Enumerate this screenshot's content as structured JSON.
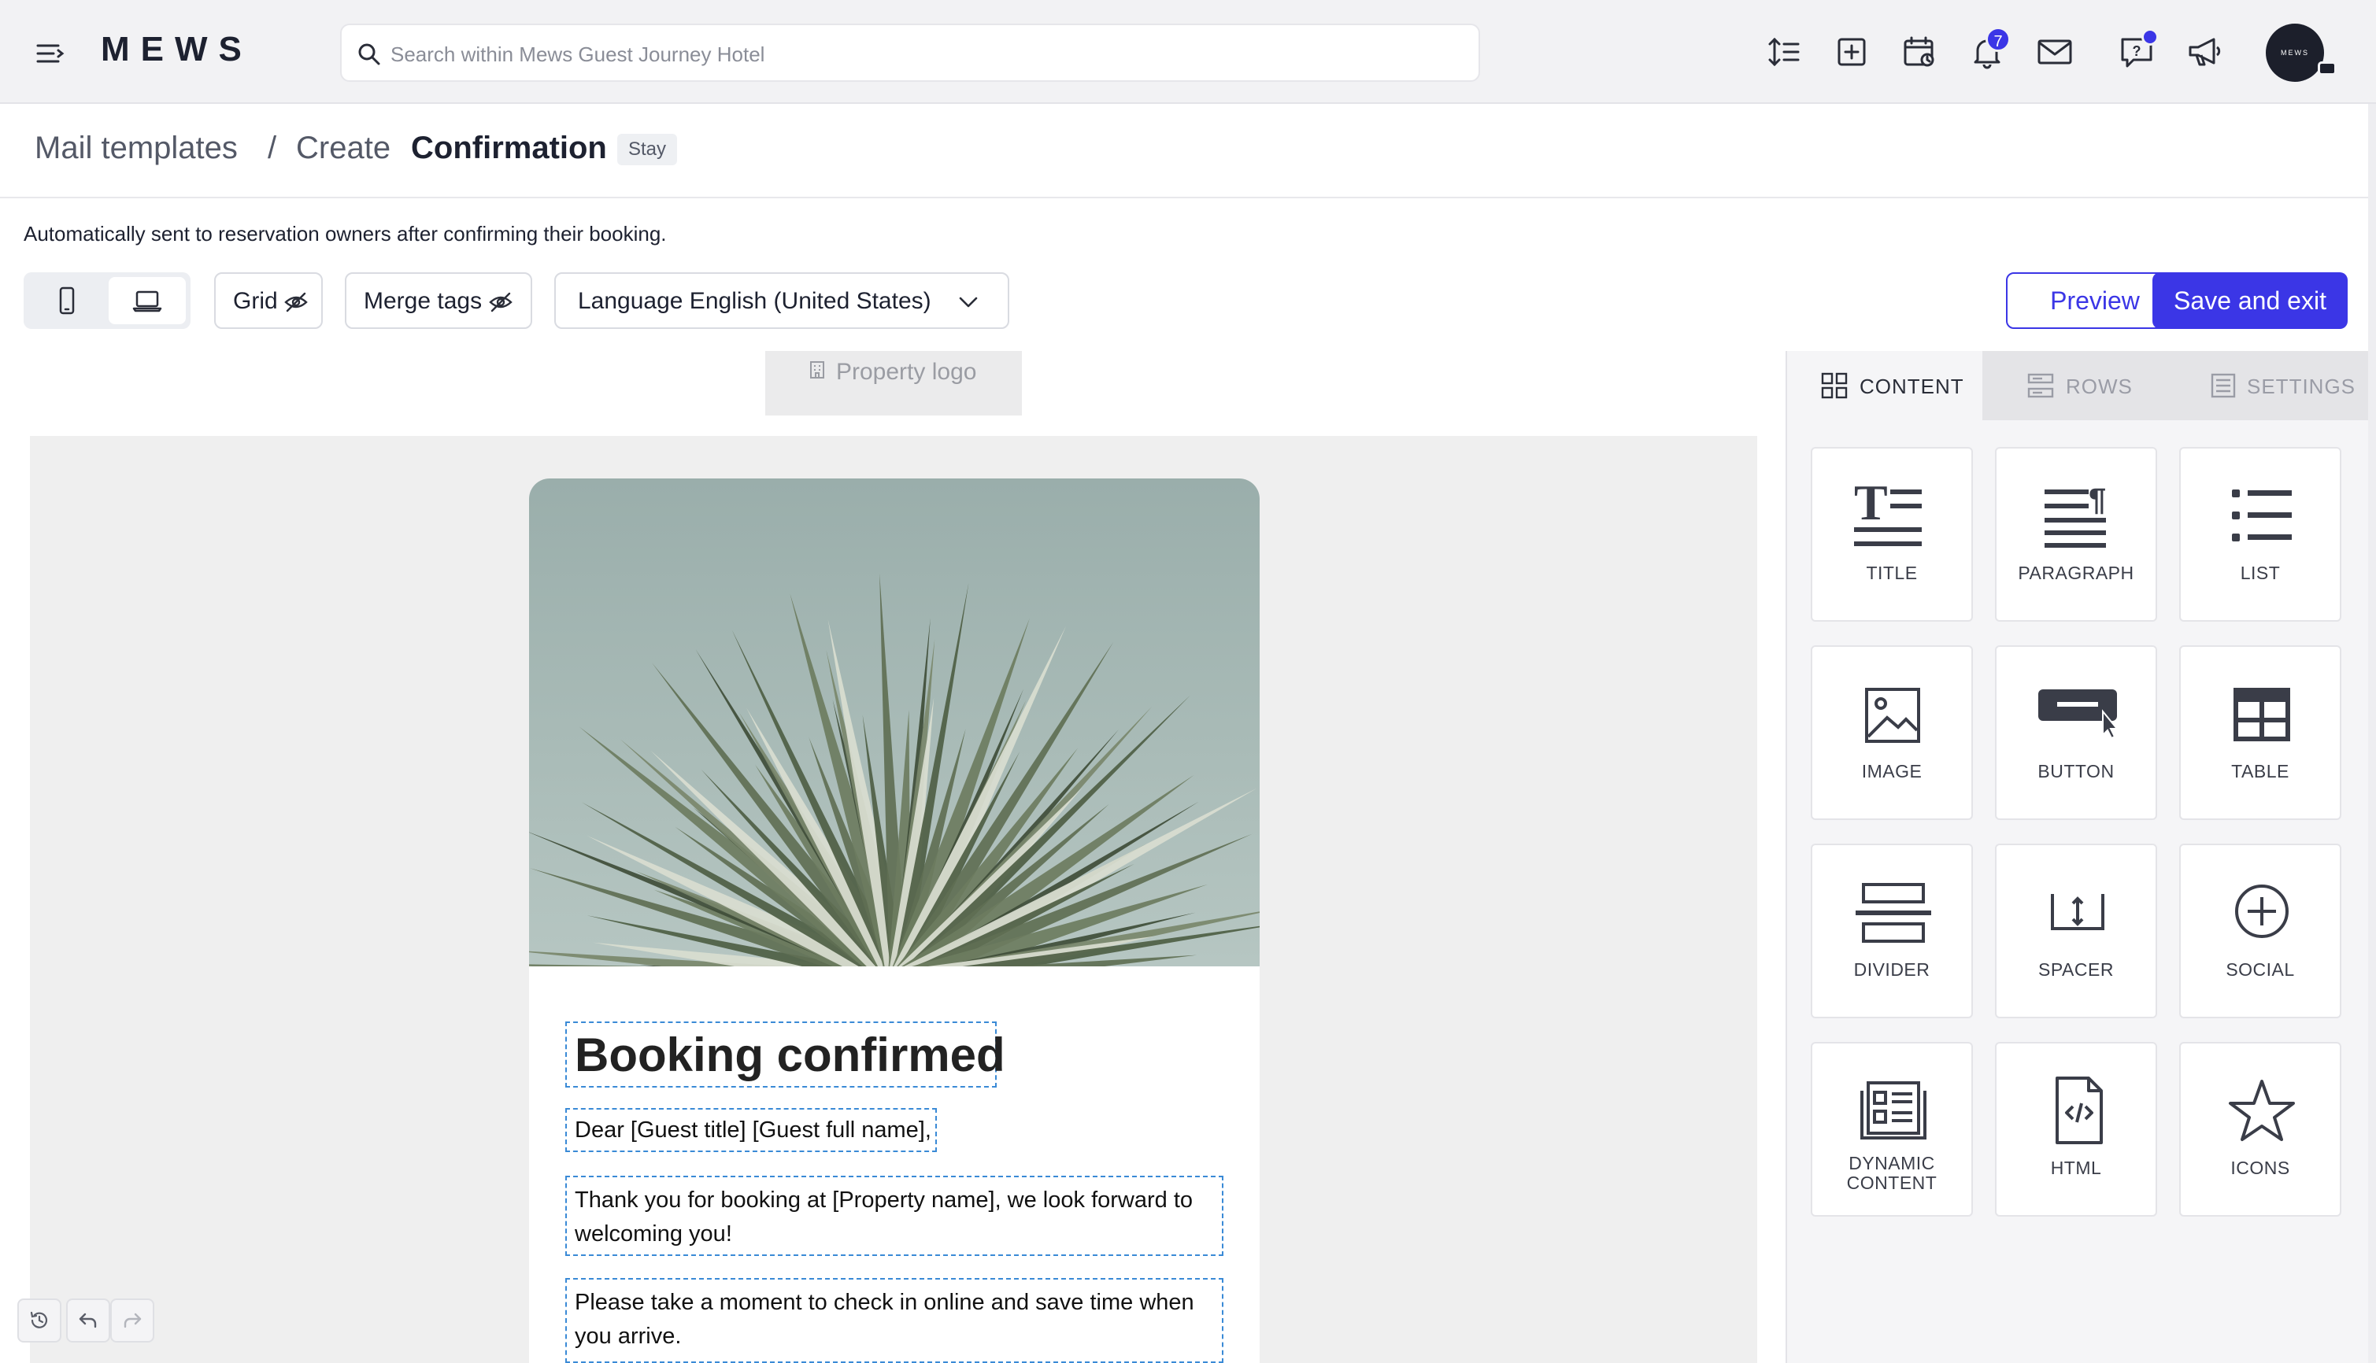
{
  "topbar": {
    "logo": "MEWS",
    "search_placeholder": "Search within Mews Guest Journey Hotel",
    "notifications_count": "7",
    "avatar_text": "MEWS"
  },
  "breadcrumb": {
    "root": "Mail templates",
    "separator": "/",
    "action": "Create",
    "current": "Confirmation",
    "badge": "Stay"
  },
  "description": "Automatically sent to reservation owners after confirming their booking.",
  "toolbar": {
    "grid_label": "Grid",
    "merge_tags_label": "Merge tags",
    "language_label": "Language English (United States)",
    "preview_label": "Preview",
    "save_label": "Save and exit"
  },
  "canvas": {
    "logo_placeholder": "Property logo",
    "email": {
      "title": "Booking confirmed",
      "greeting": "Dear [Guest title] [Guest full name],",
      "paragraph_1": "Thank you for booking at [Property name], we look forward to welcoming you!",
      "paragraph_2": "Please take a moment to check in online and save time when you arrive."
    }
  },
  "panel": {
    "tabs": [
      "CONTENT",
      "ROWS",
      "SETTINGS"
    ],
    "tiles": [
      {
        "label": "TITLE",
        "icon": "title-icon"
      },
      {
        "label": "PARAGRAPH",
        "icon": "paragraph-icon"
      },
      {
        "label": "LIST",
        "icon": "list-icon"
      },
      {
        "label": "IMAGE",
        "icon": "image-icon"
      },
      {
        "label": "BUTTON",
        "icon": "button-icon"
      },
      {
        "label": "TABLE",
        "icon": "table-icon"
      },
      {
        "label": "DIVIDER",
        "icon": "divider-icon"
      },
      {
        "label": "SPACER",
        "icon": "spacer-icon"
      },
      {
        "label": "SOCIAL",
        "icon": "social-icon"
      },
      {
        "label": "DYNAMIC CONTENT",
        "icon": "dynamic-content-icon"
      },
      {
        "label": "HTML",
        "icon": "html-icon"
      },
      {
        "label": "ICONS",
        "icon": "icons-icon"
      }
    ]
  },
  "colors": {
    "accent": "#3b36e6",
    "selection_outline": "#3a8ad6"
  }
}
